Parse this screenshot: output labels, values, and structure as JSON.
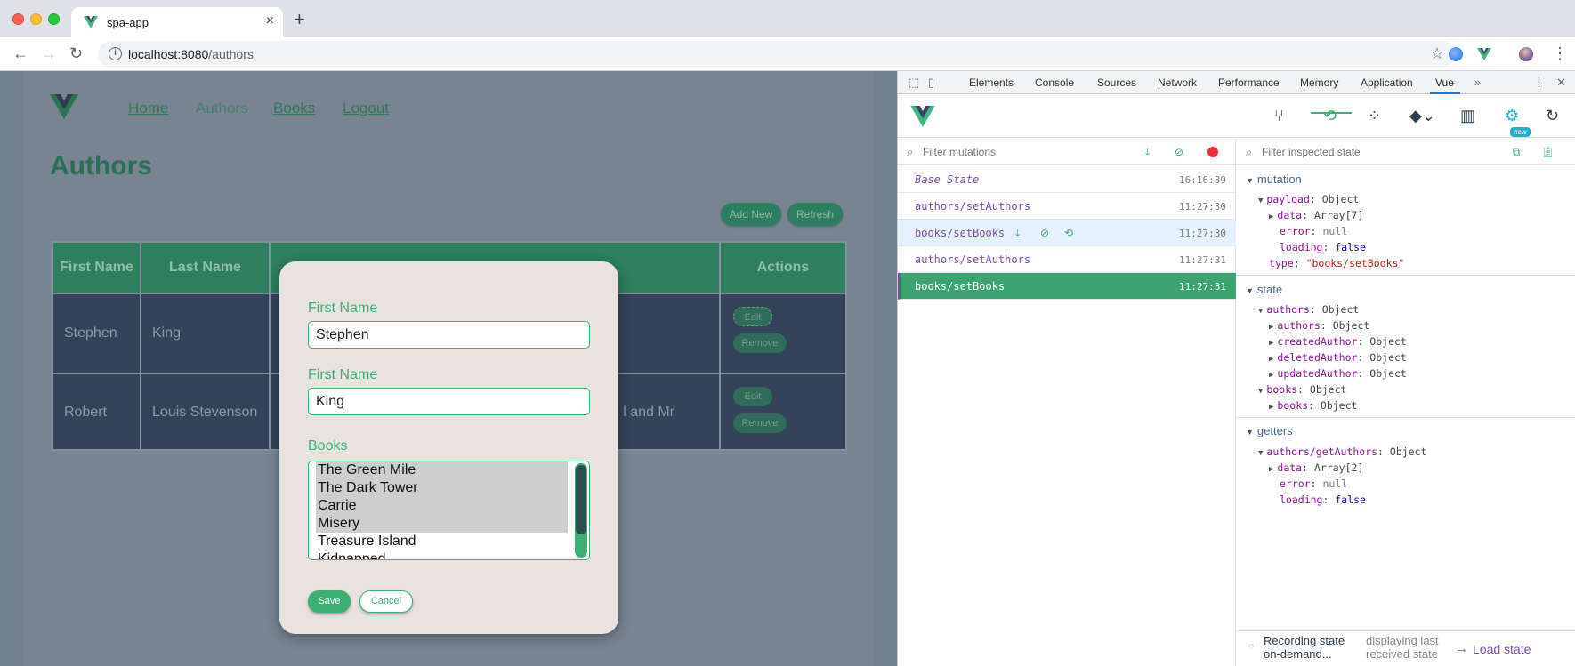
{
  "browser": {
    "tab_title": "spa-app",
    "url_host": "localhost:8080",
    "url_path": "/authors"
  },
  "app": {
    "nav": [
      "Home",
      "Authors",
      "Books",
      "Logout"
    ],
    "title": "Authors",
    "add_new": "Add New",
    "refresh": "Refresh",
    "table": {
      "headers": [
        "First Name",
        "Last Name",
        "",
        "Actions"
      ],
      "rows": [
        {
          "first": "Stephen",
          "last": "King",
          "books": ""
        },
        {
          "first": "Robert",
          "last": "Louis Stevenson",
          "books": "l and Mr"
        }
      ],
      "edit": "Edit",
      "remove": "Remove"
    }
  },
  "modal": {
    "first_name_label": "First Name",
    "first_name_value": "Stephen",
    "last_name_label": "First Name",
    "last_name_value": "King",
    "books_label": "Books",
    "books": [
      {
        "title": "The Green Mile",
        "selected": true
      },
      {
        "title": "The Dark Tower",
        "selected": true
      },
      {
        "title": "Carrie",
        "selected": true
      },
      {
        "title": "Misery",
        "selected": true
      },
      {
        "title": "Treasure Island",
        "selected": false
      },
      {
        "title": "Kidnapped",
        "selected": false
      }
    ],
    "save": "Save",
    "cancel": "Cancel"
  },
  "devtools": {
    "tabs": [
      "Elements",
      "Console",
      "Sources",
      "Network",
      "Performance",
      "Memory",
      "Application",
      "Vue"
    ],
    "active_tab": "Vue",
    "new_badge": "new",
    "filter_mutations": "Filter mutations",
    "filter_state": "Filter inspected state",
    "mutations": [
      {
        "name": "Base State",
        "time": "16:16:39"
      },
      {
        "name": "authors/setAuthors",
        "time": "11:27:30"
      },
      {
        "name": "books/setBooks",
        "time": "11:27:30"
      },
      {
        "name": "authors/setAuthors",
        "time": "11:27:31"
      },
      {
        "name": "books/setBooks",
        "time": "11:27:31"
      }
    ],
    "sections": {
      "mutation": "mutation",
      "state": "state",
      "getters": "getters"
    },
    "tree": {
      "payload_k": "payload",
      "payload_v": "Object",
      "data_k": "data",
      "data_v": "Array[7]",
      "error_k": "error",
      "error_v": "null",
      "loading_k": "loading",
      "loading_v": "false",
      "type_k": "type",
      "type_v": "\"books/setBooks\"",
      "authors_k": "authors",
      "authors_v": "Object",
      "authors2_k": "authors",
      "authors2_v": "Object",
      "created_k": "createdAuthor",
      "created_v": "Object",
      "deleted_k": "deletedAuthor",
      "deleted_v": "Object",
      "updated_k": "updatedAuthor",
      "updated_v": "Object",
      "books_k": "books",
      "books_v": "Object",
      "books2_k": "books",
      "books2_v": "Object",
      "getauthors_k": "authors/getAuthors",
      "getauthors_v": "Object",
      "gdata_k": "data",
      "gdata_v": "Array[2]",
      "gerror_k": "error",
      "gerror_v": "null",
      "gloading_k": "loading",
      "gloading_v": "false"
    },
    "footer": {
      "recording": "Recording state on-demand...",
      "displaying": "displaying last received state",
      "load": "Load state"
    }
  },
  "colors": {
    "vue_green": "#3dae74",
    "mutation_purple": "#7a4fa8",
    "active_row": "#3ba271"
  }
}
